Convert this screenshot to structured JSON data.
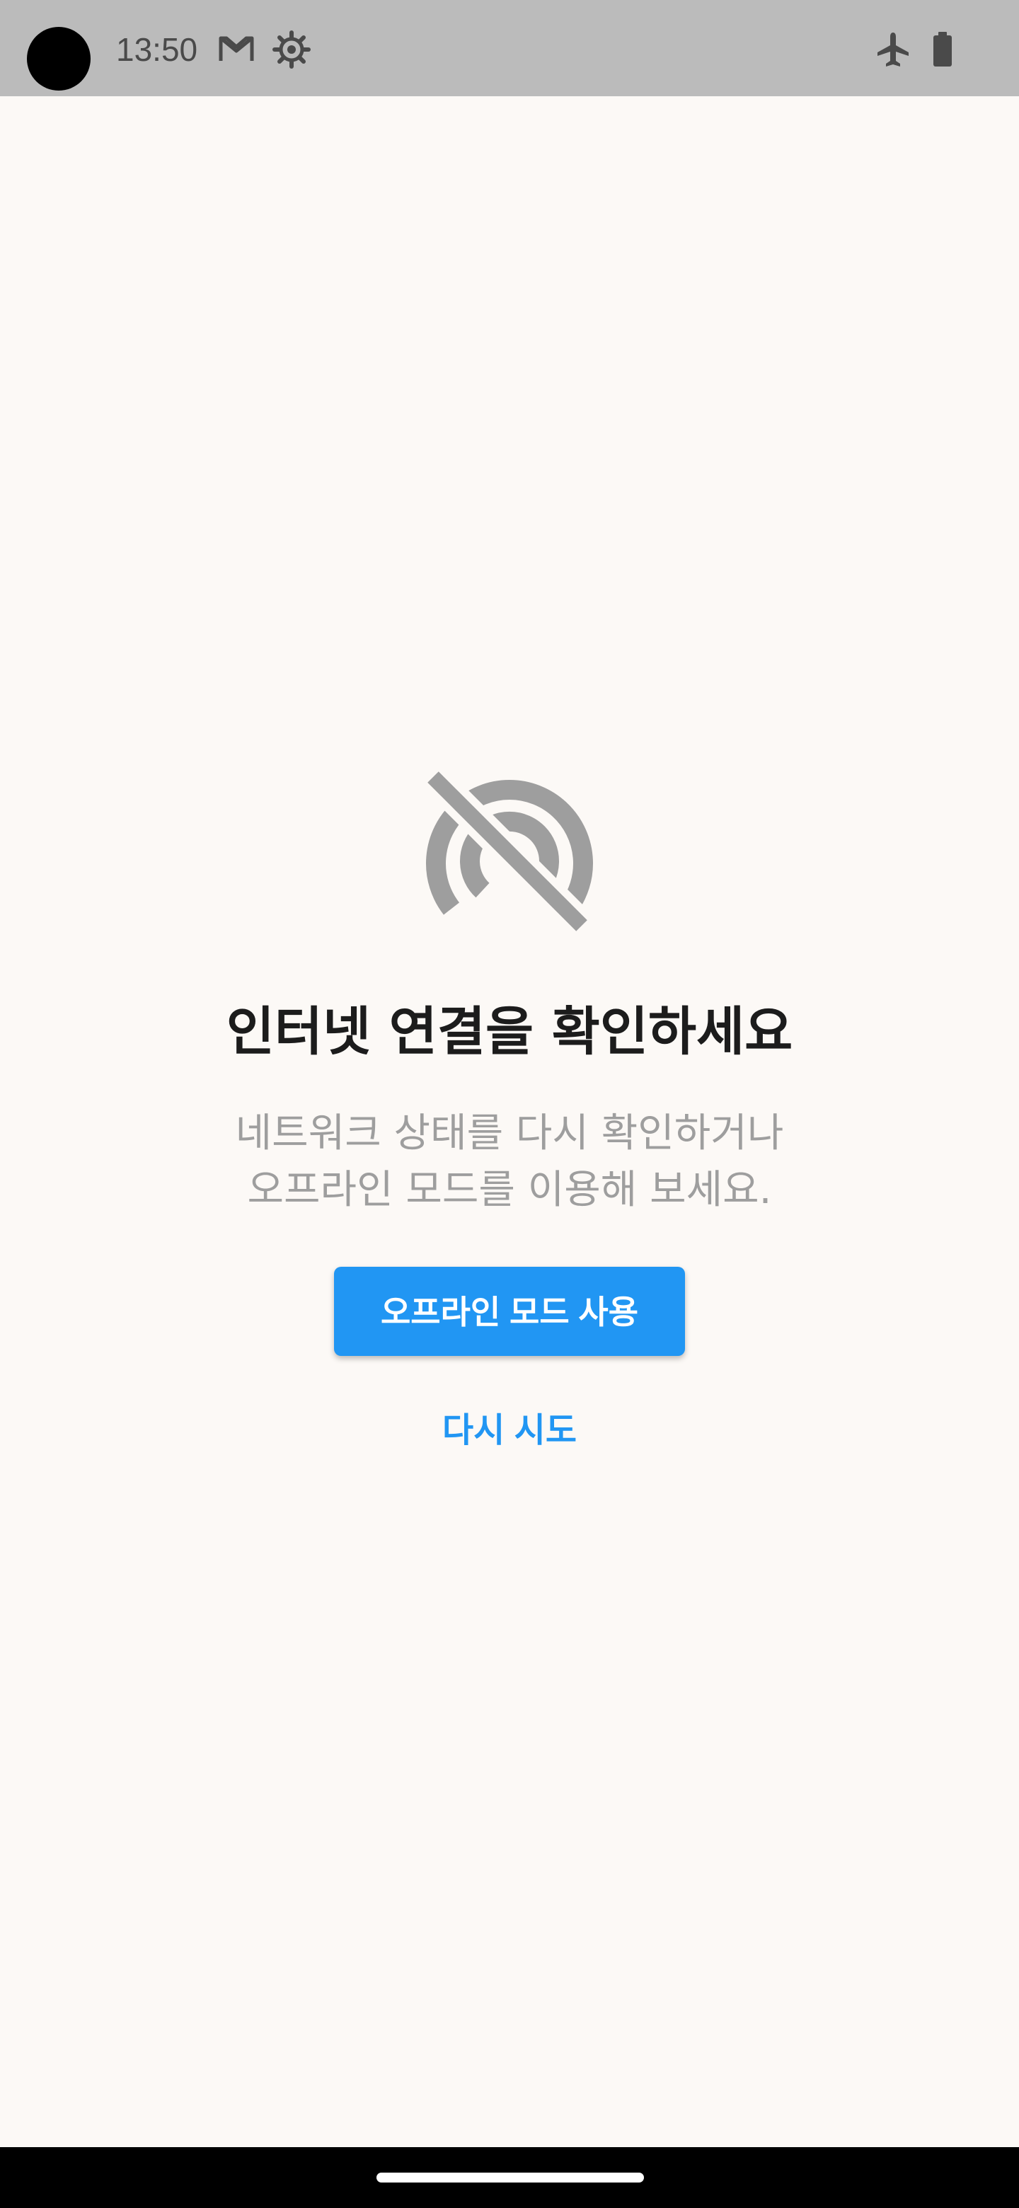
{
  "status_bar": {
    "time": "13:50",
    "icons": [
      "gmail-icon",
      "settings-gear-icon",
      "airplane-mode-icon",
      "battery-icon"
    ]
  },
  "offline_screen": {
    "icon": "wifi-off-icon",
    "title": "인터넷 연결을 확인하세요",
    "subtitle": "네트워크 상태를 다시 확인하거나\n오프라인 모드를 이용해 보세요.",
    "primary_button_label": "오프라인 모드 사용",
    "retry_button_label": "다시 시도"
  },
  "colors": {
    "status_bar_bg": "#BBBBBB",
    "page_bg": "#FCF9F6",
    "accent": "#2196F3",
    "title_text": "#1C1C1C",
    "subtitle_text": "#9E9E9E",
    "icon_gray": "#9E9E9E"
  }
}
